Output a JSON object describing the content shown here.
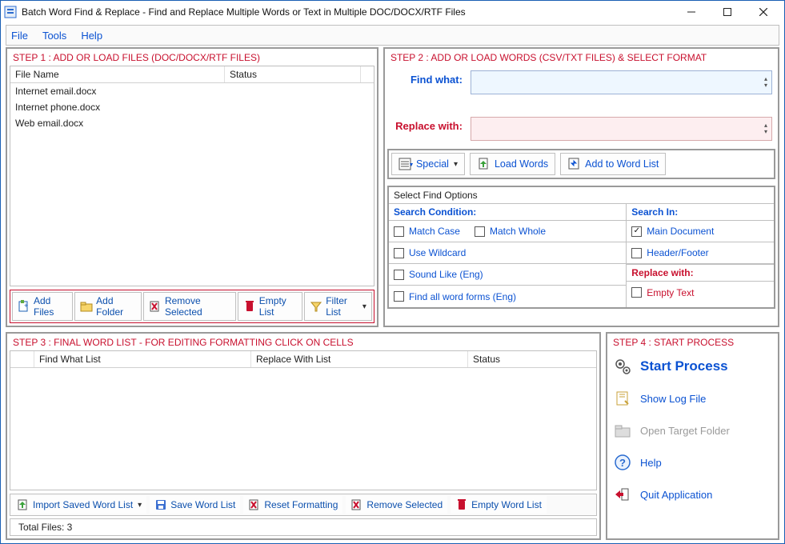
{
  "titlebar": {
    "title": "Batch Word Find & Replace - Find and Replace Multiple Words or Text  in Multiple DOC/DOCX/RTF Files"
  },
  "menubar": {
    "file": "File",
    "tools": "Tools",
    "help": "Help"
  },
  "step1": {
    "title": "STEP 1 : ADD OR LOAD FILES (DOC/DOCX/RTF FILES)",
    "col_filename": "File Name",
    "col_status": "Status",
    "rows": [
      {
        "name": "Internet email.docx",
        "status": ""
      },
      {
        "name": "Internet phone.docx",
        "status": ""
      },
      {
        "name": "Web email.docx",
        "status": ""
      }
    ],
    "btn_add_files": "Add Files",
    "btn_add_folder": "Add Folder",
    "btn_remove_selected": "Remove Selected",
    "btn_empty_list": "Empty List",
    "btn_filter_list": "Filter List"
  },
  "step2": {
    "title": "STEP 2 : ADD OR LOAD WORDS (CSV/TXT FILES) & SELECT FORMAT",
    "find_label": "Find what:",
    "replace_label": "Replace with:",
    "find_value": "",
    "replace_value": "",
    "btn_special": "Special",
    "btn_load_words": "Load Words",
    "btn_add_to_list": "Add to Word List",
    "options_title": "Select Find Options",
    "search_condition": "Search Condition:",
    "search_in": "Search In:",
    "chk_match_case": "Match Case",
    "chk_match_whole": "Match Whole",
    "chk_use_wildcard": "Use Wildcard",
    "chk_sound_like": "Sound Like (Eng)",
    "chk_all_word_forms": "Find all word forms (Eng)",
    "chk_main_doc": "Main Document",
    "chk_header_footer": "Header/Footer",
    "replace_with_head": "Replace with:",
    "chk_empty_text": "Empty Text"
  },
  "step3": {
    "title": "STEP 3 : FINAL WORD LIST - FOR EDITING FORMATTING CLICK ON CELLS",
    "col_sel": "",
    "col_find": "Find What List",
    "col_replace": "Replace With List",
    "col_status": "Status",
    "btn_import": "Import Saved Word List",
    "btn_save": "Save Word List",
    "btn_reset": "Reset Formatting",
    "btn_remove": "Remove Selected",
    "btn_empty": "Empty Word List",
    "status": "Total Files: 3"
  },
  "step4": {
    "title": "STEP 4 : START PROCESS",
    "btn_start": "Start Process",
    "btn_log": "Show Log File",
    "btn_target": "Open Target Folder",
    "btn_help": "Help",
    "btn_quit": "Quit Application"
  }
}
